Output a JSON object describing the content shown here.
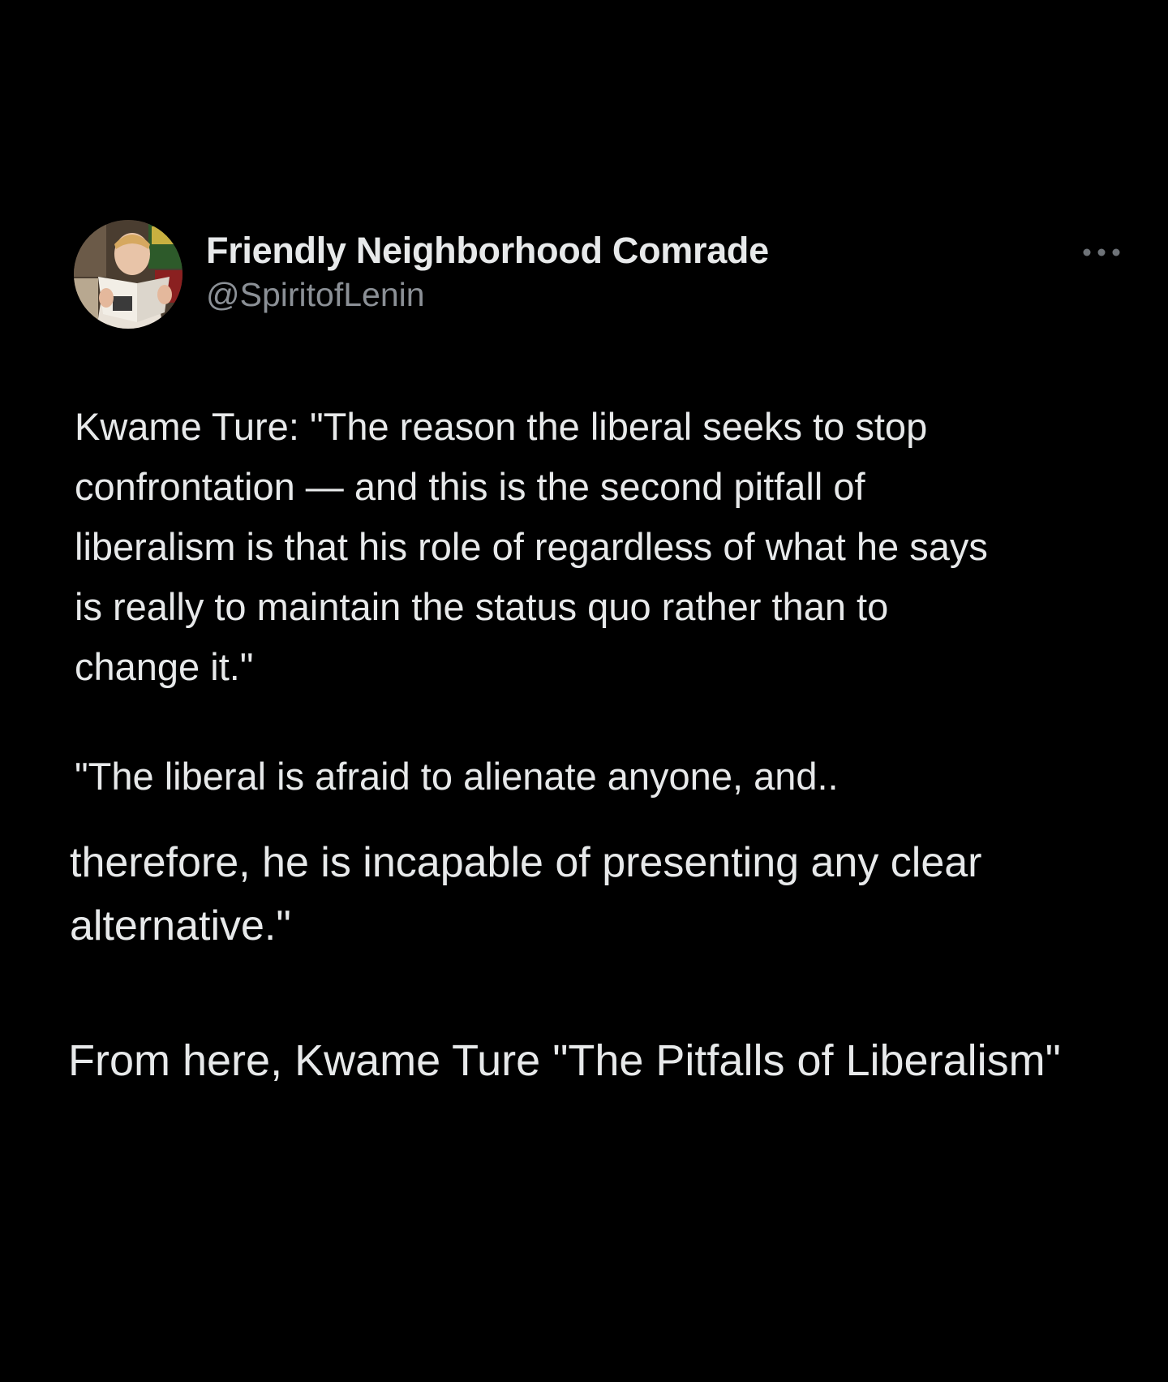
{
  "tweet": {
    "author": {
      "display_name": "Friendly Neighborhood Comrade",
      "handle": "@SpiritofLenin",
      "avatar_icon": "profile-photo"
    },
    "more_icon": "ellipsis-icon",
    "body": {
      "paragraph_1": [
        "Kwame Ture: \"The reason the liberal seeks to stop",
        "confrontation — and this is the second pitfall of",
        "liberalism is that his role of regardless of what he says",
        "is really to maintain the status quo rather than to",
        "change it.\""
      ],
      "paragraph_2": "\"The liberal is afraid to alienate anyone, and..",
      "paragraph_3": [
        "therefore, he is incapable of presenting any clear",
        "alternative.\""
      ],
      "paragraph_4": "From here, Kwame Ture \"The Pitfalls of Liberalism\""
    }
  },
  "colors": {
    "background": "#000000",
    "primary_text": "#e7e9ea",
    "secondary_text": "#8b9096"
  }
}
